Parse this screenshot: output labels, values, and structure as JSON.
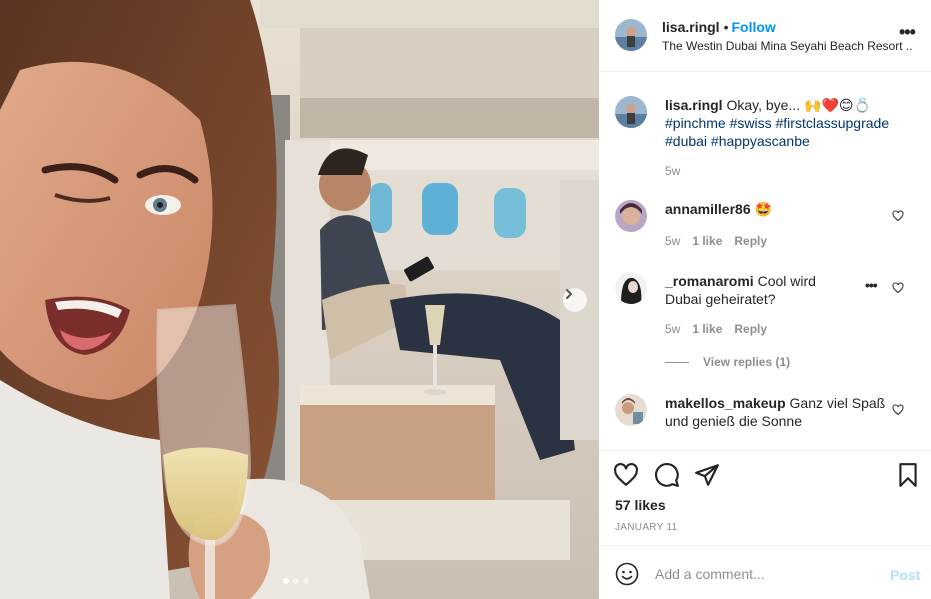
{
  "post": {
    "username": "lisa.ringl",
    "follow_label": "Follow",
    "bullet": "•",
    "location": "The Westin Dubai Mina Seyahi Beach Resort ...",
    "more_label": "•••",
    "image_count": 3,
    "active_image": 1
  },
  "caption": {
    "username": "lisa.ringl",
    "text": "Okay, bye... 🙌❤️😊💍",
    "hashtags_line1": "#pinchme #swiss #firstclassupgrade",
    "hashtags_line2": "#dubai #happyascanbe",
    "time": "5w"
  },
  "comments": [
    {
      "username": "annamiller86",
      "text": "🤩",
      "time": "5w",
      "likes": "1 like",
      "reply": "Reply"
    },
    {
      "username": "_romanaromi",
      "text": "Cool wird Dubai geheiratet?",
      "time": "5w",
      "likes": "1 like",
      "reply": "Reply",
      "more": "•••",
      "view_replies": "View replies (1)"
    },
    {
      "username": "makellos_makeup",
      "text": "Ganz viel Spaß und genieß die Sonne"
    }
  ],
  "actions": {
    "likes": "57 likes",
    "date": "JANUARY 11"
  },
  "add_comment": {
    "placeholder": "Add a comment...",
    "post_label": "Post"
  },
  "colors": {
    "link_blue": "#0095f6",
    "hashtag": "#00376b",
    "muted": "#8e8e8e",
    "post_disabled": "#b2dffc"
  }
}
